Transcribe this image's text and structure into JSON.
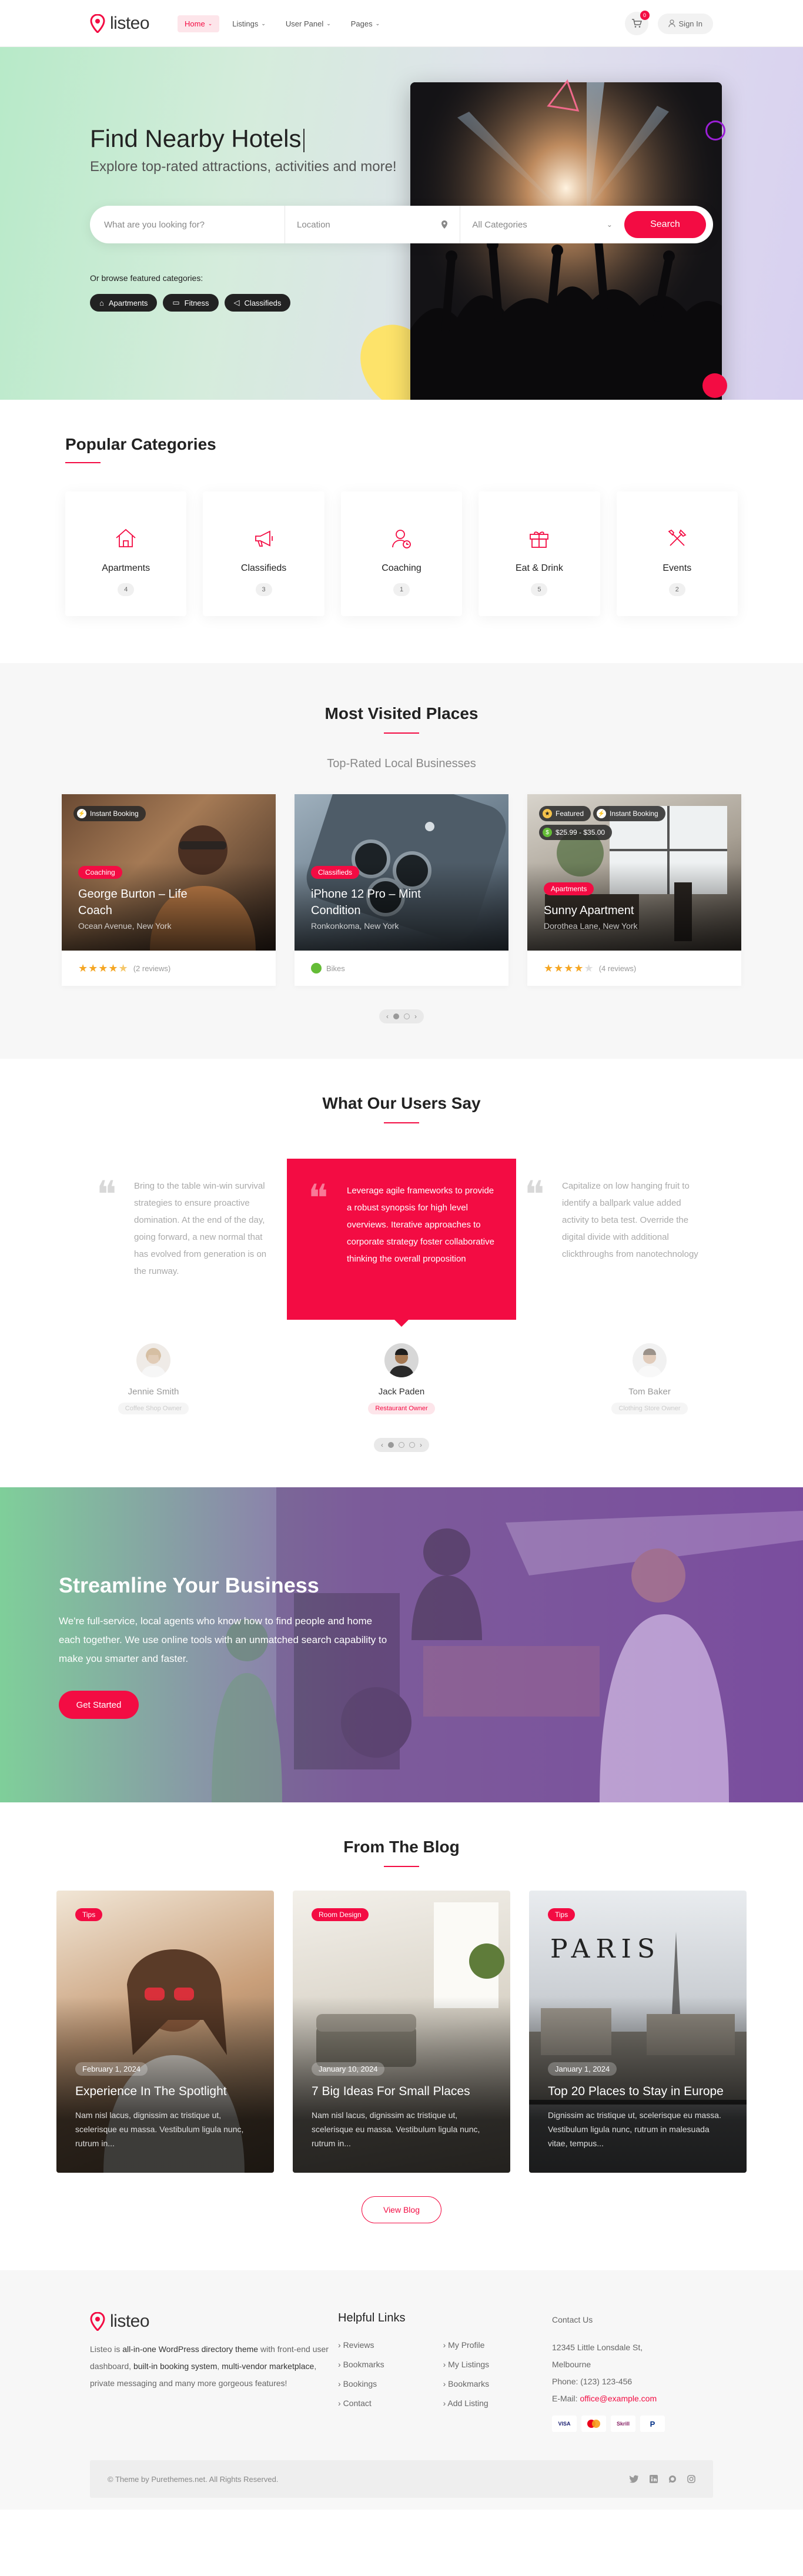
{
  "header": {
    "logo": "listeo",
    "nav": [
      {
        "label": "Home",
        "active": true
      },
      {
        "label": "Listings",
        "active": false
      },
      {
        "label": "User Panel",
        "active": false
      },
      {
        "label": "Pages",
        "active": false
      }
    ],
    "cart_count": "0",
    "signin_label": "Sign In"
  },
  "hero": {
    "title": "Find Nearby Hotels",
    "subtitle": "Explore top-rated attractions, activities and more!",
    "search": {
      "what_placeholder": "What are you looking for?",
      "location_placeholder": "Location",
      "category_value": "All Categories",
      "button": "Search"
    },
    "featured_label": "Or browse featured categories:",
    "chips": [
      "Apartments",
      "Fitness",
      "Classifieds"
    ]
  },
  "categories": {
    "title": "Popular Categories",
    "items": [
      {
        "label": "Apartments",
        "count": "4",
        "icon": "house-icon"
      },
      {
        "label": "Classifieds",
        "count": "3",
        "icon": "megaphone-icon"
      },
      {
        "label": "Coaching",
        "count": "1",
        "icon": "coaching-icon"
      },
      {
        "label": "Eat & Drink",
        "count": "5",
        "icon": "gift-icon"
      },
      {
        "label": "Events",
        "count": "2",
        "icon": "tools-icon"
      }
    ]
  },
  "visited": {
    "title": "Most Visited Places",
    "subtitle": "Top-Rated Local Businesses",
    "listings": [
      {
        "badges": [
          "Instant Booking"
        ],
        "tag": "Coaching",
        "title_l1": "George Burton – Life",
        "title_l2": "Coach",
        "location": "Ocean Avenue, New York",
        "rating": 4.5,
        "reviews": "(2 reviews)"
      },
      {
        "badges": [],
        "tag": "Classifieds",
        "title_l1": "iPhone 12 Pro – Mint",
        "title_l2": "Condition",
        "location": "Ronkonkoma, New York",
        "footer_label": "Bikes"
      },
      {
        "badges": [
          "Featured",
          "Instant Booking"
        ],
        "price": "$25.99 - $35.00",
        "tag": "Apartments",
        "title_l1": "Sunny Apartment",
        "title_l2": "",
        "location": "Dorothea Lane, New York",
        "rating": 4,
        "reviews": "(4 reviews)"
      }
    ]
  },
  "testimonials": {
    "title": "What Our Users Say",
    "items": [
      {
        "text": "Bring to the table win-win survival strategies to ensure proactive domination. At the end of the day, going forward, a new normal that has evolved from generation is on the runway.",
        "name": "Jennie Smith",
        "role": "Coffee Shop Owner"
      },
      {
        "text": "Leverage agile frameworks to provide a robust synopsis for high level overviews. Iterative approaches to corporate strategy foster collaborative thinking the overall proposition",
        "name": "Jack Paden",
        "role": "Restaurant Owner"
      },
      {
        "text": "Capitalize on low hanging fruit to identify a ballpark value added activity to beta test. Override the digital divide with additional clickthroughs from nanotechnology",
        "name": "Tom Baker",
        "role": "Clothing Store Owner"
      }
    ]
  },
  "business": {
    "title": "Streamline Your Business",
    "text": "We're full-service, local agents who know how to find people and home each together. We use online tools with an unmatched search capability to make you smarter and faster.",
    "button": "Get Started"
  },
  "blog": {
    "title": "From The Blog",
    "posts": [
      {
        "tag": "Tips",
        "date": "February 1, 2024",
        "title": "Experience In The Spotlight",
        "excerpt": "Nam nisl lacus, dignissim ac tristique ut, scelerisque eu massa. Vestibulum ligula nunc, rutrum in..."
      },
      {
        "tag": "Room Design",
        "date": "January 10, 2024",
        "title": "7 Big Ideas For Small Places",
        "excerpt": "Nam nisl lacus, dignissim ac tristique ut, scelerisque eu massa. Vestibulum ligula nunc, rutrum in..."
      },
      {
        "tag": "Tips",
        "date": "January 1, 2024",
        "title": "Top 20 Places to Stay in Europe",
        "excerpt": "Dignissim ac tristique ut, scelerisque eu massa. Vestibulum ligula nunc, rutrum in malesuada vitae, tempus..."
      }
    ],
    "view_button": "View Blog",
    "paris_sign": "PARIS"
  },
  "footer": {
    "logo": "listeo",
    "about_parts": [
      "Listeo is ",
      "all-in-one WordPress directory theme",
      " with front-end user dashboard, ",
      "built-in booking system",
      ", ",
      "multi-vendor marketplace",
      ", private messaging and many more gorgeous features!"
    ],
    "links_title": "Helpful Links",
    "links_col1": [
      "Reviews",
      "Bookmarks",
      "Bookings",
      "Contact"
    ],
    "links_col2": [
      "My Profile",
      "My Listings",
      "Bookmarks",
      "Add Listing"
    ],
    "contact_title": "Contact Us",
    "address_l1": "12345 Little Lonsdale St,",
    "address_l2": "Melbourne",
    "phone": "Phone: (123) 123-456",
    "email_label": "E-Mail: ",
    "email": "office@example.com",
    "payments": [
      "VISA",
      "MC",
      "Skrill",
      "PayPal"
    ],
    "copyright": "© Theme by Purethemes.net. All Rights Reserved."
  },
  "colors": {
    "accent": "#f30c43",
    "dark": "#222222"
  }
}
